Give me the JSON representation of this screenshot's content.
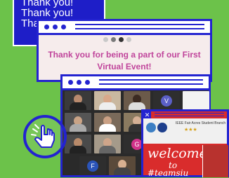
{
  "thank_you_panel": {
    "lines": [
      "Thank you!",
      "Thank you!",
      "Tha"
    ]
  },
  "main_card": {
    "message": "Thank you for being a part of our First Virtual Event!"
  },
  "zoom_window": {
    "avatar_letters": [
      "V",
      "G",
      "F"
    ]
  },
  "welcome_window": {
    "header_title": "IEEE Fair Acres Student Branch",
    "stars": "★★★",
    "welcome": "welcome!",
    "to": "to",
    "hashtag": "#teamsiu"
  },
  "colors": {
    "background": "#6cc24a",
    "frame_blue": "#2323d0",
    "message_pink": "#c0449b",
    "welcome_red": "#d92c2c"
  }
}
